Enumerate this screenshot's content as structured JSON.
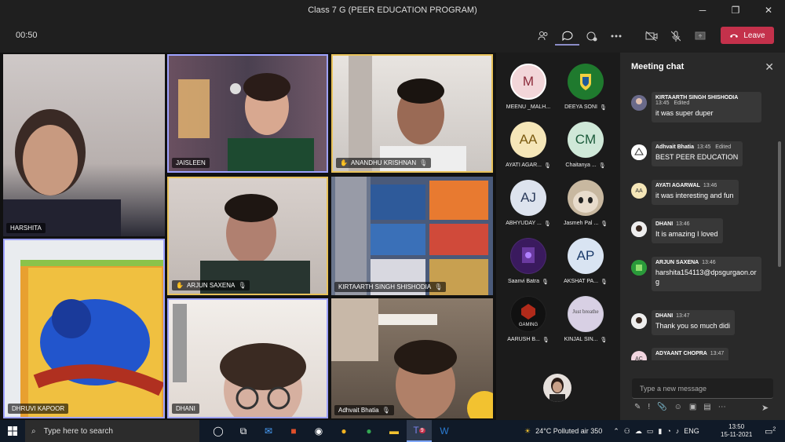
{
  "window": {
    "title": "Class 7 G (PEER EDUCATION PROGRAM)",
    "minimize": "─",
    "maximize": "❐",
    "close": "✕"
  },
  "toolbar": {
    "timer": "00:50",
    "leave_label": "Leave"
  },
  "tiles": [
    {
      "name": "HARSHITA",
      "hand": false,
      "mic": false
    },
    {
      "name": "JAISLEEN",
      "hand": false,
      "mic": false
    },
    {
      "name": "ANANDHU KRISHNAN",
      "hand": true,
      "mic": true
    },
    {
      "name": "ARJUN SAXENA",
      "hand": true,
      "mic": true
    },
    {
      "name": "KIRTAARTH SINGH SHISHODIA",
      "hand": false,
      "mic": true
    },
    {
      "name": "DHRUVI KAPOOR",
      "hand": false,
      "mic": false
    },
    {
      "name": "DHANI",
      "hand": false,
      "mic": false
    },
    {
      "name": "Adhvait Bhatia",
      "hand": false,
      "mic": true
    }
  ],
  "roster": [
    {
      "name": "MEENU _MALH...",
      "initials": "M",
      "color": "#f2d6d9",
      "mic": false
    },
    {
      "name": "DEEYA SONI",
      "initials": "",
      "color": "#1f7a2e",
      "mic": true
    },
    {
      "name": "AYATI AGAR...",
      "initials": "AA",
      "color": "#f5e6b8",
      "mic": true
    },
    {
      "name": "Chaitanya ...",
      "initials": "CM",
      "color": "#cfe8d8",
      "mic": true
    },
    {
      "name": "ABHYUDAY ...",
      "initials": "AJ",
      "color": "#dde3ee",
      "mic": true
    },
    {
      "name": "Jasmeh Pal ...",
      "initials": "",
      "color": "#c8b8a0",
      "mic": true
    },
    {
      "name": "Saanvi Batra",
      "initials": "",
      "color": "#4a2a6e",
      "mic": true
    },
    {
      "name": "AKSHAT PA...",
      "initials": "AP",
      "color": "#d9e4f2",
      "mic": true
    },
    {
      "name": "AARUSH B...",
      "initials": "",
      "color": "#222222",
      "mic": true
    },
    {
      "name": "KINJAL SIN...",
      "initials": "",
      "color": "#c9c5d6",
      "mic": true
    }
  ],
  "avatar_brand_texts": {
    "deeya": "",
    "aarush": "GAMING",
    "kinjal": "Just breathe"
  },
  "chat": {
    "title": "Meeting chat",
    "messages": [
      {
        "author": "KIRTAARTH SINGH SHISHODIA",
        "time": "13:45",
        "edited": "Edited",
        "text": "it was super duper",
        "avatar_initials": ""
      },
      {
        "author": "Adhvait Bhatia",
        "time": "13:45",
        "edited": "Edited",
        "text": "BEST PEER EDUCATION",
        "avatar_initials": ""
      },
      {
        "author": "AYATI AGARWAL",
        "time": "13:46",
        "edited": "",
        "text": "it was interesting and fun",
        "avatar_initials": "AA"
      },
      {
        "author": "DHANI",
        "time": "13:46",
        "edited": "",
        "text": "It is amazing I loved",
        "avatar_initials": ""
      },
      {
        "author": "ARJUN SAXENA",
        "time": "13:46",
        "edited": "",
        "text": "harshita154113@dpsgurgaon.org",
        "avatar_initials": ""
      },
      {
        "author": "DHANI",
        "time": "13:47",
        "edited": "",
        "text": "Thank you so much didi",
        "avatar_initials": ""
      },
      {
        "author": "ADYAANT CHOPRA",
        "time": "13:47",
        "edited": "",
        "text": "",
        "avatar_initials": "AC"
      }
    ],
    "compose_placeholder": "Type a new message"
  },
  "taskbar": {
    "search_placeholder": "Type here to search",
    "weather": "24°C  Polluted air 350",
    "lang": "ENG",
    "time": "13:50",
    "date": "15-11-2021",
    "teams_badge": "9",
    "notif_count": "2"
  }
}
